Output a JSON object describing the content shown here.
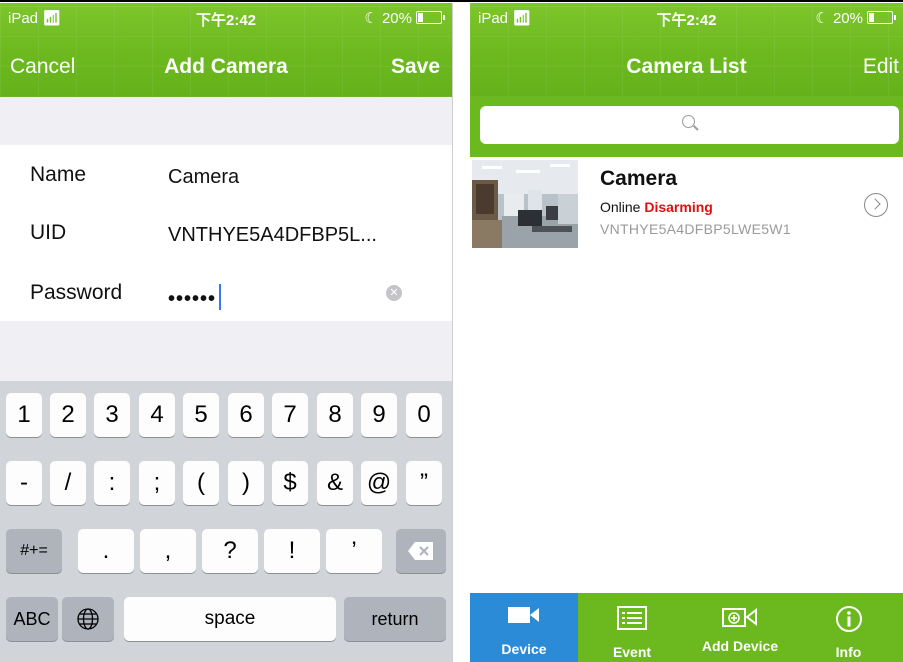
{
  "status_bar": {
    "device": "iPad",
    "time": "下午2:42",
    "battery": "20%"
  },
  "add_camera": {
    "cancel": "Cancel",
    "title": "Add Camera",
    "save": "Save",
    "fields": [
      {
        "label": "Name",
        "value": "Camera"
      },
      {
        "label": "UID",
        "value": "VNTHYE5A4DFBP5L..."
      },
      {
        "label": "Password",
        "value": "••••••"
      }
    ]
  },
  "keyboard": {
    "row1": [
      "1",
      "2",
      "3",
      "4",
      "5",
      "6",
      "7",
      "8",
      "9",
      "0"
    ],
    "row2": [
      "-",
      "/",
      ":",
      ";",
      "(",
      ")",
      "$",
      "&",
      "@",
      "”"
    ],
    "row3": [
      ".",
      ",",
      "?",
      "!",
      "’"
    ],
    "shift": "#+=",
    "abc": "ABC",
    "space": "space",
    "return": "return"
  },
  "camera_list": {
    "title": "Camera List",
    "edit": "Edit",
    "cameras": [
      {
        "name": "Camera",
        "online": "Online",
        "state": "Disarming",
        "uid": "VNTHYE5A4DFBP5LWE5W1"
      }
    ]
  },
  "tabs": [
    {
      "label": "Device",
      "icon": "video-camera-icon"
    },
    {
      "label": "Event",
      "icon": "list-icon"
    },
    {
      "label": "Add Device",
      "icon": "add-camera-icon"
    },
    {
      "label": "Info",
      "icon": "info-icon"
    }
  ],
  "colors": {
    "green": "#6cb91f",
    "tab_active": "#2c8bd6",
    "alert": "#e01010"
  }
}
